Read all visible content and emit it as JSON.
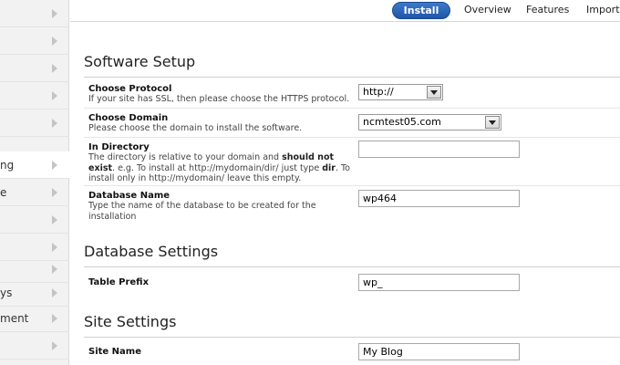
{
  "sidebar": {
    "items": [
      {
        "label": ""
      },
      {
        "label": ""
      },
      {
        "label": ""
      },
      {
        "label": ""
      },
      {
        "label": ""
      },
      {
        "label": "ng"
      },
      {
        "label": "e"
      },
      {
        "label": ""
      },
      {
        "label": ""
      },
      {
        "label": ""
      },
      {
        "label": "ys"
      },
      {
        "label": "ment"
      },
      {
        "label": ""
      }
    ]
  },
  "tabs": {
    "install": "Install",
    "overview": "Overview",
    "features": "Features",
    "import": "Import"
  },
  "software_setup": {
    "title": "Software Setup",
    "protocol": {
      "label": "Choose Protocol",
      "help": "If your site has SSL, then please choose the HTTPS protocol.",
      "value": "http://"
    },
    "domain": {
      "label": "Choose Domain",
      "help": "Please choose the domain to install the software.",
      "value": "ncmtest05.com"
    },
    "directory": {
      "label": "In Directory",
      "help_1": "The directory is relative to your domain and ",
      "help_bold_1": "should not exist",
      "help_2": ". e.g. To install at http://mydomain/dir/ just type ",
      "help_bold_2": "dir",
      "help_3": ". To install only in http://mydomain/ leave this empty.",
      "value": ""
    },
    "database": {
      "label": "Database Name",
      "help": "Type the name of the database to be created for the installation",
      "value": "wp464"
    }
  },
  "database_settings": {
    "title": "Database Settings",
    "table_prefix": {
      "label": "Table Prefix",
      "value": "wp_"
    }
  },
  "site_settings": {
    "title": "Site Settings",
    "site_name": {
      "label": "Site Name",
      "value": "My Blog"
    }
  }
}
